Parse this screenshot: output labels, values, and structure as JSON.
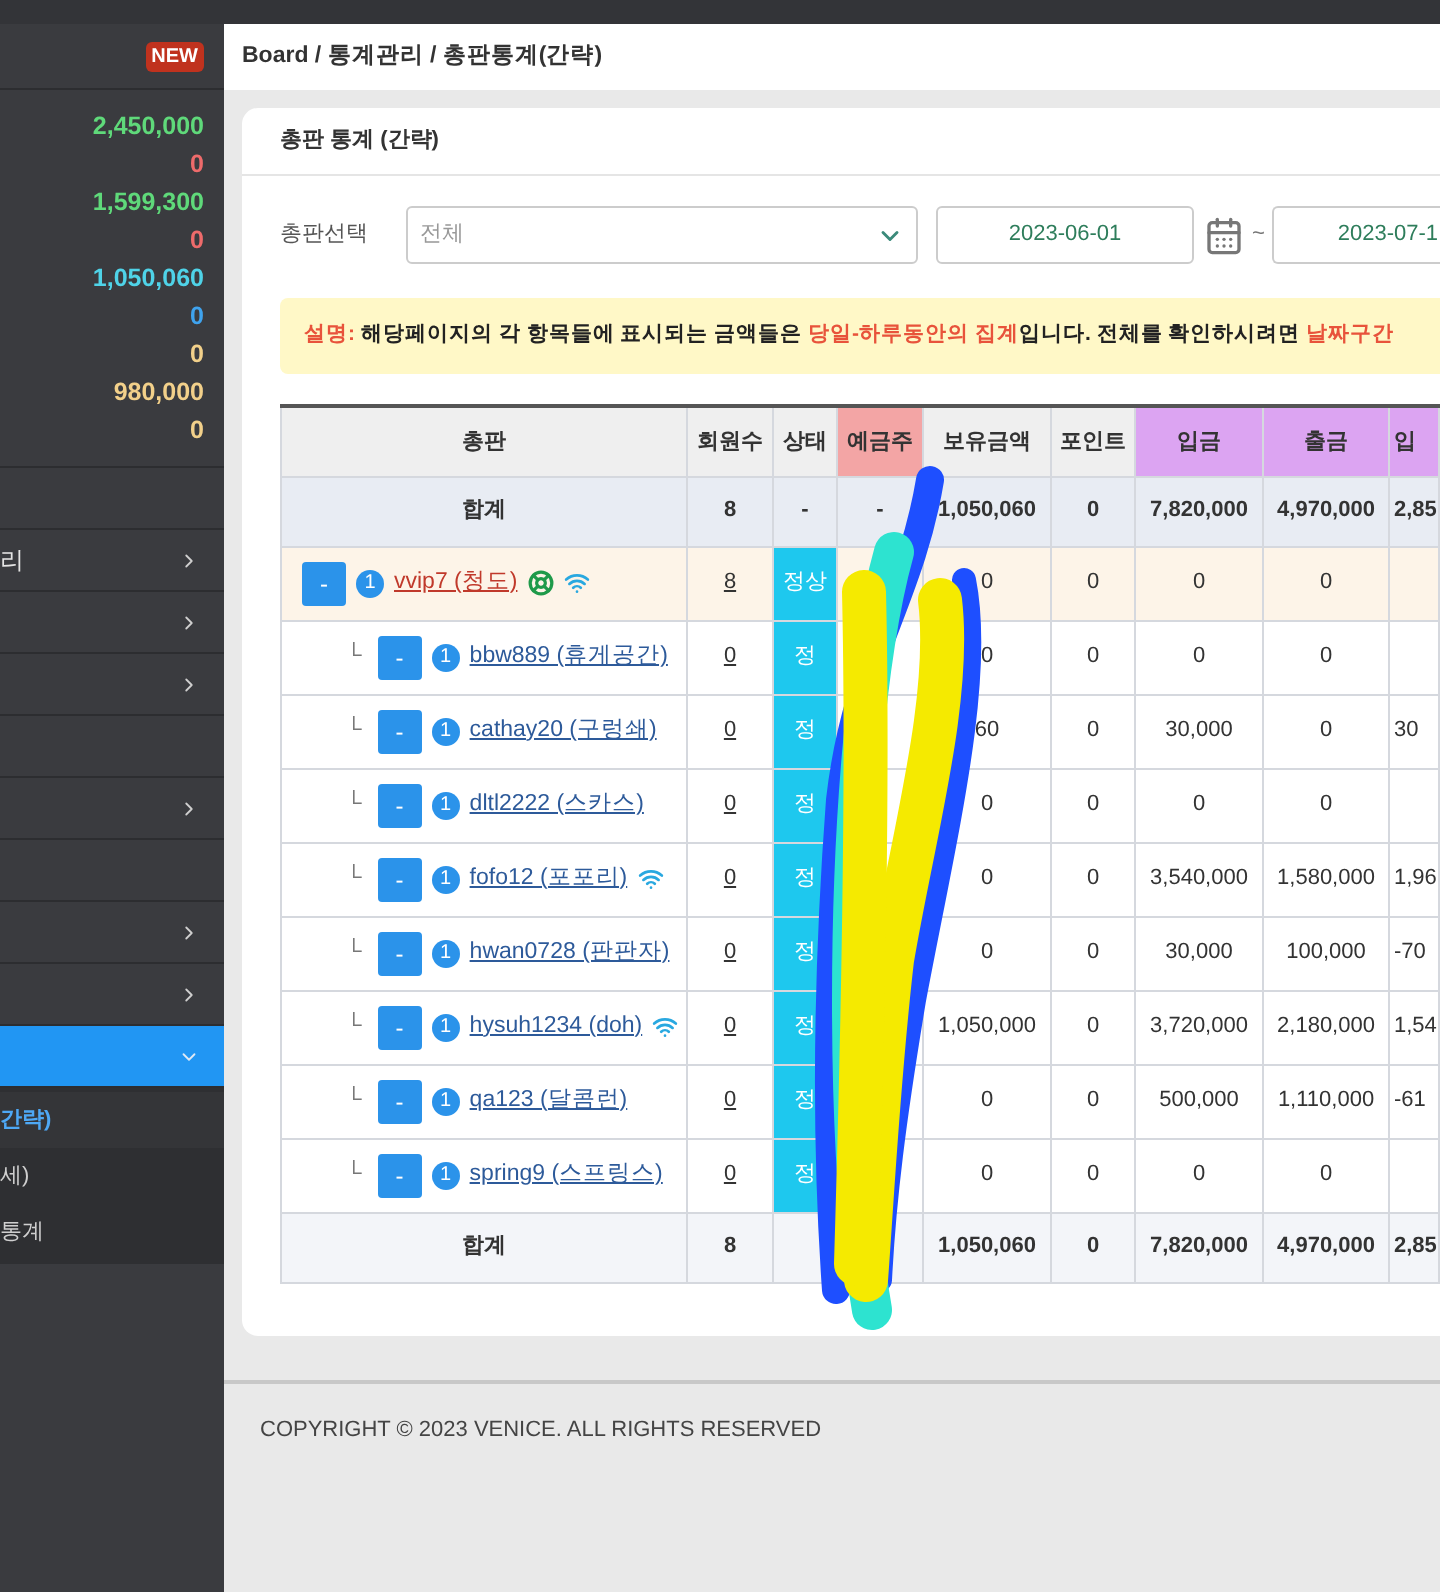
{
  "sidebar": {
    "badge": "NEW",
    "stats": [
      {
        "value": "2,450,000",
        "color": "#5fd97a"
      },
      {
        "value": "0",
        "color": "#ee6b6b"
      },
      {
        "value": "1,599,300",
        "color": "#5fd97a"
      },
      {
        "value": "0",
        "color": "#ee6b6b"
      },
      {
        "value": "1,050,060",
        "color": "#4fd3e8"
      },
      {
        "value": "0",
        "color": "#3fa3ee"
      },
      {
        "value": "0",
        "color": "#f2d08a"
      },
      {
        "value": "980,000",
        "color": "#f2d08a"
      },
      {
        "value": "0",
        "color": "#f2d08a"
      }
    ],
    "menu": [
      {
        "arrow": false,
        "selected": false
      },
      {
        "label": "리",
        "arrow": true,
        "selected": false
      },
      {
        "arrow": true,
        "selected": false
      },
      {
        "arrow": true,
        "selected": false
      },
      {
        "arrow": false,
        "selected": false
      },
      {
        "arrow": true,
        "selected": false
      },
      {
        "arrow": false,
        "selected": false
      },
      {
        "arrow": true,
        "selected": false
      },
      {
        "arrow": true,
        "selected": false
      },
      {
        "arrow": true,
        "selected": true,
        "expanded": true
      }
    ],
    "submenu": [
      {
        "label": "간략)",
        "selected": true
      },
      {
        "label": "세)",
        "selected": false
      },
      {
        "label": "통계",
        "selected": false
      }
    ]
  },
  "breadcrumb": "Board / 통계관리 / 총판통계(간략)",
  "card": {
    "title": "총판 통계 (간략)",
    "filter": {
      "label": "총판선택",
      "select_value": "전체",
      "date_from": "2023-06-01",
      "separator": "~",
      "date_to": "2023-07-1"
    },
    "notice": [
      {
        "text": "설명: ",
        "emphasis": true
      },
      {
        "text": "해당페이지의 각 항목들에 표시되는 금액들은 ",
        "emphasis": false
      },
      {
        "text": "당일-하루동안의 집계",
        "emphasis": true
      },
      {
        "text": "입니다. 전체를 확인하시려면 ",
        "emphasis": false
      },
      {
        "text": "날짜구간",
        "emphasis": true
      }
    ],
    "table": {
      "columns": [
        {
          "label": "총판"
        },
        {
          "label": "회원수"
        },
        {
          "label": "상태"
        },
        {
          "label": "예금주",
          "color": "#f3a5a5"
        },
        {
          "label": "보유금액"
        },
        {
          "label": "포인트"
        },
        {
          "label": "입금",
          "color": "#dca4f2"
        },
        {
          "label": "출금",
          "color": "#dca4f2"
        },
        {
          "label": "입",
          "color": "#dca4f2"
        }
      ],
      "summary": {
        "label": "합계",
        "members": "8",
        "status": "-",
        "holder": "-",
        "balance": "1,050,060",
        "points": "0",
        "deposit": "7,820,000",
        "withdrawal": "4,970,000",
        "column_9": "2,85"
      },
      "rows": [
        {
          "toggle": "-",
          "level_badge": "1",
          "name": "vvip7 (청도)",
          "icons": [
            {
              "kind": "lifebuoy"
            },
            {
              "kind": "wifi"
            }
          ],
          "highlighted": true,
          "members": "8",
          "status": "정상",
          "balance": "0",
          "points": "0",
          "deposit": "0",
          "withdrawal": "0",
          "children": [
            {
              "branch": "└",
              "toggle": "-",
              "level_badge": "1",
              "name": "bbw889 (휴게공간)",
              "highlighted": false,
              "members": "0",
              "status": "정",
              "balance": "0",
              "points": "0",
              "deposit": "0",
              "withdrawal": "0"
            },
            {
              "branch": "└",
              "toggle": "-",
              "level_badge": "1",
              "name": "cathay20 (구렁쇄)",
              "highlighted": false,
              "members": "0",
              "status": "정",
              "balance": "60",
              "points": "0",
              "deposit": "30,000",
              "withdrawal": "0",
              "column_9": "30"
            },
            {
              "branch": "└",
              "toggle": "-",
              "level_badge": "1",
              "name": "dltl2222 (스카스)",
              "highlighted": false,
              "members": "0",
              "status": "정",
              "balance": "0",
              "points": "0",
              "deposit": "0",
              "withdrawal": "0"
            },
            {
              "branch": "└",
              "toggle": "-",
              "level_badge": "1",
              "name": "fofo12 (포포리)",
              "icons": [
                {
                  "kind": "wifi"
                }
              ],
              "highlighted": false,
              "members": "0",
              "status": "정",
              "balance": "0",
              "points": "0",
              "deposit": "3,540,000",
              "withdrawal": "1,580,000",
              "column_9": "1,96"
            },
            {
              "branch": "└",
              "toggle": "-",
              "level_badge": "1",
              "name": "hwan0728 (판판자)",
              "highlighted": false,
              "members": "0",
              "status": "정",
              "balance": "0",
              "points": "0",
              "deposit": "30,000",
              "withdrawal": "100,000",
              "column_9": "-70"
            },
            {
              "branch": "└",
              "toggle": "-",
              "level_badge": "1",
              "name": "hysuh1234 (doh)",
              "icons": [
                {
                  "kind": "wifi"
                }
              ],
              "highlighted": false,
              "members": "0",
              "status": "정",
              "balance": "1,050,000",
              "points": "0",
              "deposit": "3,720,000",
              "withdrawal": "2,180,000",
              "column_9": "1,54"
            },
            {
              "branch": "└",
              "toggle": "-",
              "level_badge": "1",
              "name": "qa123 (달콤런)",
              "highlighted": false,
              "members": "0",
              "status": "정",
              "balance": "0",
              "points": "0",
              "deposit": "500,000",
              "withdrawal": "1,110,000",
              "column_9": "-61"
            },
            {
              "branch": "└",
              "toggle": "-",
              "level_badge": "1",
              "name": "spring9 (스프링스)",
              "highlighted": false,
              "members": "0",
              "status": "정",
              "balance": "0",
              "points": "0",
              "deposit": "0",
              "withdrawal": "0"
            }
          ]
        }
      ],
      "footer": {
        "label": "합계",
        "members": "8",
        "balance": "1,050,060",
        "points": "0",
        "deposit": "7,820,000",
        "withdrawal": "4,970,000",
        "column_9": "2,85"
      }
    }
  },
  "copyright": "COPYRIGHT © 2023 VENICE. ALL RIGHTS RESERVED"
}
